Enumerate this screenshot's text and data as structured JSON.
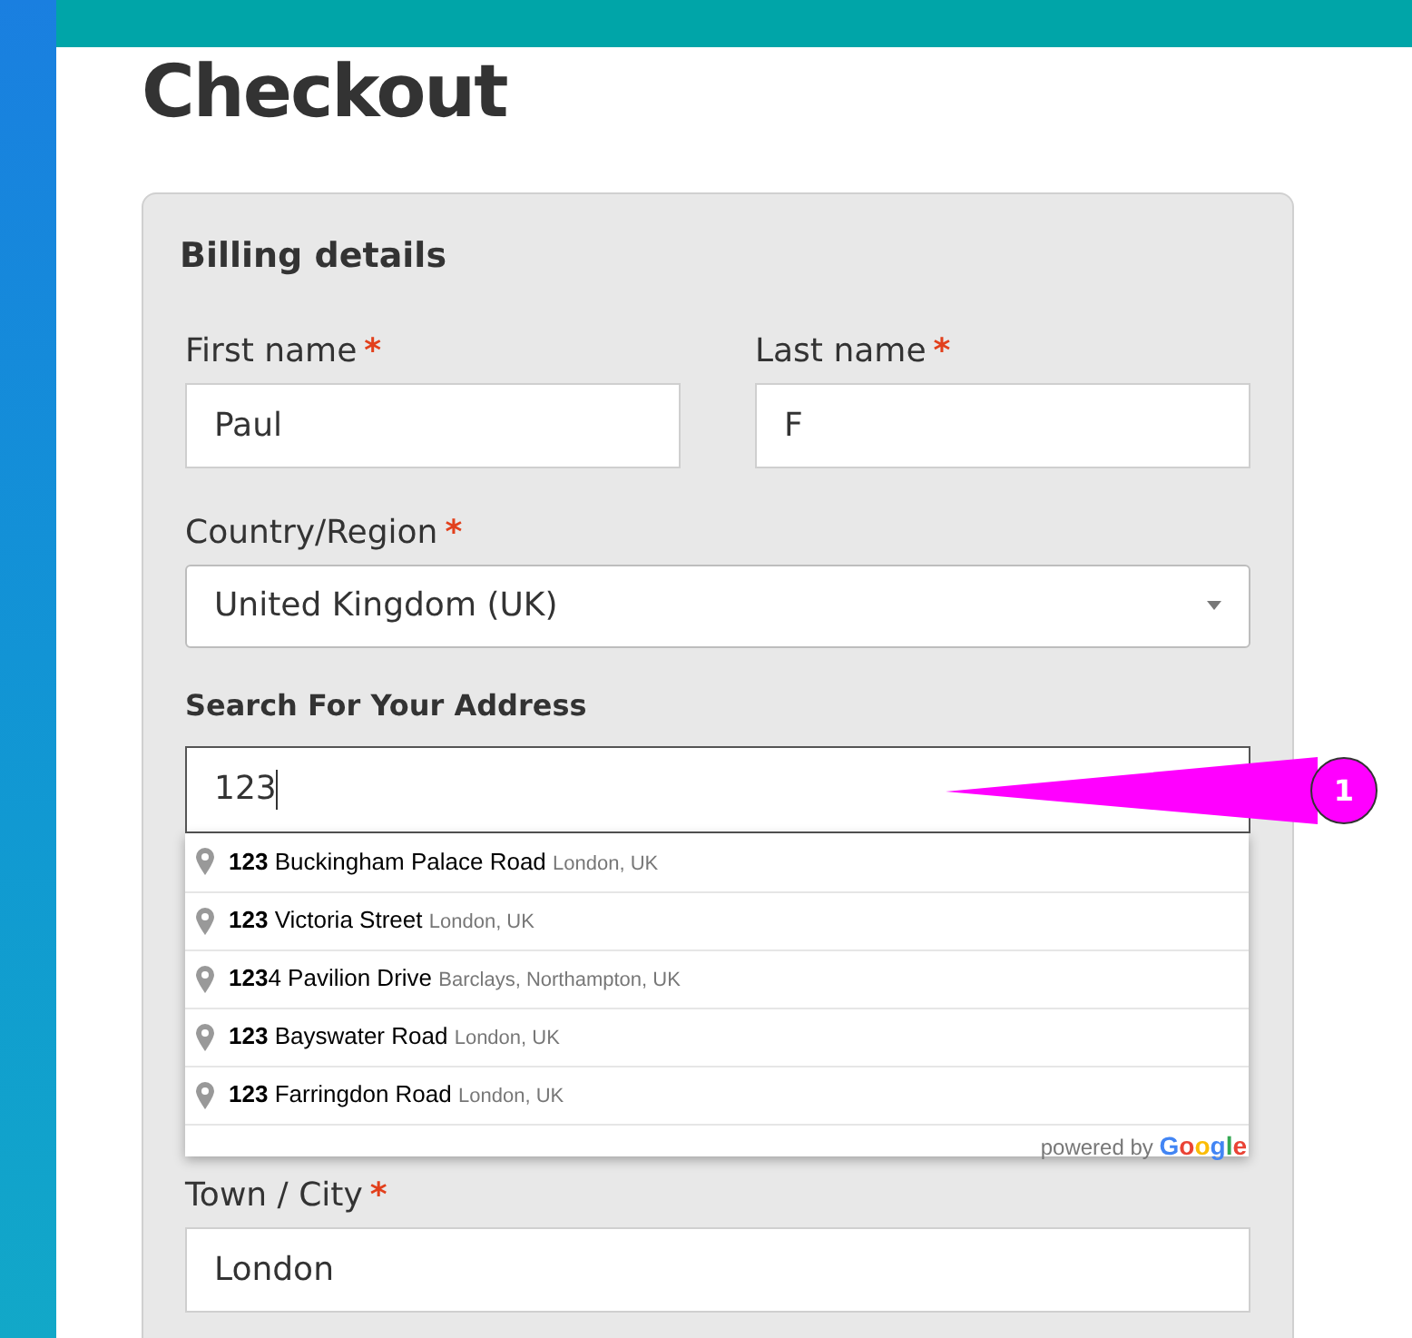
{
  "page": {
    "title": "Checkout"
  },
  "billing": {
    "title": "Billing details",
    "first_name": {
      "label": "First name",
      "required_mark": "*",
      "value": "Paul"
    },
    "last_name": {
      "label": "Last name",
      "required_mark": "*",
      "value": "F"
    },
    "country": {
      "label": "Country/Region",
      "required_mark": "*",
      "value": "United Kingdom (UK)"
    },
    "address_search": {
      "label": "Search For Your Address",
      "value": "123",
      "suggestions": [
        {
          "main": "**123** Buckingham Palace Road",
          "secondary": "London, UK"
        },
        {
          "main": "**123** Victoria Street",
          "secondary": "London, UK"
        },
        {
          "main": "**123**4 Pavilion Drive",
          "secondary": "Barclays, Northampton, UK"
        },
        {
          "main": "**123** Bayswater Road",
          "secondary": "London, UK"
        },
        {
          "main": "**123** Farringdon Road",
          "secondary": "London, UK"
        }
      ],
      "attribution": {
        "prefix": "powered by",
        "brand": [
          "G",
          "o",
          "o",
          "g",
          "l",
          "e"
        ]
      }
    },
    "town": {
      "label": "Town / City",
      "required_mark": "*",
      "value": "London"
    }
  },
  "callout": {
    "label": "1"
  }
}
